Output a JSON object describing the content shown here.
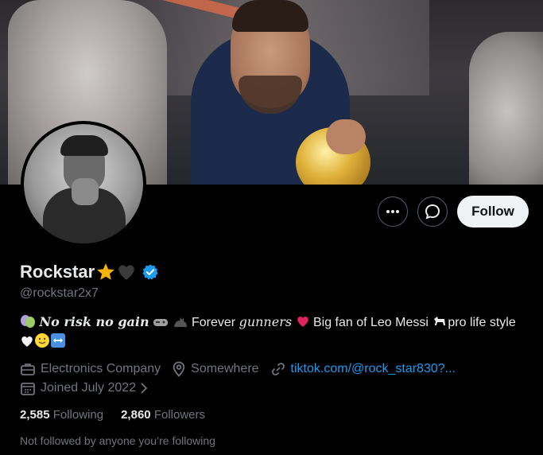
{
  "profile": {
    "display_name": "Rockstar",
    "name_emojis": [
      "star",
      "black-heart"
    ],
    "verified_color": "#1d9bf0",
    "handle": "@rockstar2x7",
    "bio": {
      "part1_fancy": "𝑵𝒐 𝒓𝒊𝒔𝒌 𝒏𝒐 𝒈𝒂𝒊𝒏",
      "part2": " Forever ",
      "part3_fancy": "𝑔𝑢𝑛𝑛𝑒𝑟𝑠",
      "part4": " Big fan of Leo Messi ",
      "part5": "pro life style "
    },
    "meta": {
      "category": "Electronics Company",
      "location": "Somewhere",
      "link": "tiktok.com/@rock_star830?...",
      "joined": "Joined July 2022"
    },
    "stats": {
      "following_count": "2,585",
      "following_label": "Following",
      "followers_count": "2,860",
      "followers_label": "Followers"
    },
    "not_followed_text": "Not followed by anyone you’re following"
  },
  "actions": {
    "more_icon": "more-dots-icon",
    "message_icon": "message-icon",
    "follow_label": "Follow"
  },
  "colors": {
    "background": "#000000",
    "primary_text": "#e7e9ea",
    "secondary_text": "#71767b",
    "link": "#1d9bf0",
    "follow_button_bg": "#eff3f4"
  }
}
